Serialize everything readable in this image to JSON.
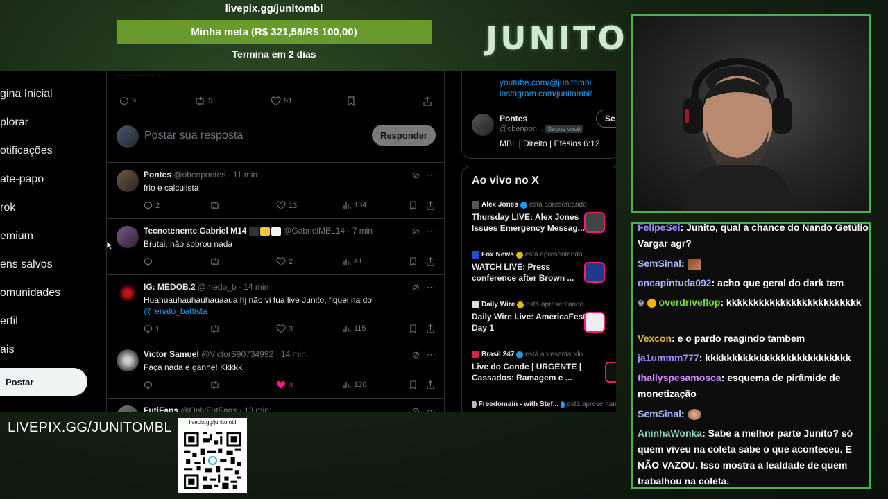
{
  "overlay": {
    "livepix_url": "livepix.gg/junitombl",
    "goal_text": "Minha meta (R$ 321,58/R$ 100,00)",
    "goal_progress": 1.0,
    "ends_text": "Termina em 2 dias",
    "logo": "JUNITO",
    "bottom_link": "LIVEPIX.GG/JUNITOMBL",
    "qr_label": "livepix.gg/junitombl"
  },
  "sidebar": {
    "items": [
      "gina Inicial",
      "plorar",
      "otificações",
      "ate-papo",
      "rok",
      "emium",
      "ens salvos",
      "omunidades",
      "erfil",
      "ais"
    ],
    "post_button": "Postar"
  },
  "feed": {
    "truncated_line": "... .... ..............",
    "top_actions": {
      "replies": "9",
      "reposts": "5",
      "likes": "91"
    },
    "reply_placeholder": "Postar sua resposta",
    "reply_button": "Responder",
    "tweets": [
      {
        "name": "Pontes",
        "handle": "@obenpontes · 11 min",
        "text": "frio e calculista",
        "replies": "2",
        "reposts": "",
        "likes": "13",
        "views": "134"
      },
      {
        "name": "Tecnotenente Gabriel M14",
        "handle": "@GabrielMBL14 · 7 min",
        "text": "Brutal, não sobrou nada",
        "replies": "",
        "reposts": "",
        "likes": "2",
        "views": "41"
      },
      {
        "name": "IG: MEDOB.2",
        "handle": "@medo_b · 14 min",
        "text": "Huahuauhauhauhauaaua hj não vi tua live Junito, fiquei na do",
        "mention": "@renato_battista",
        "replies": "1",
        "reposts": "",
        "likes": "3",
        "views": "115"
      },
      {
        "name": "Victor Samuel",
        "handle": "@VictorS90734992 · 14 min",
        "text": "Faça nada e ganhe! Kkkkk",
        "replies": "",
        "reposts": "",
        "likes": "3",
        "views": "120"
      },
      {
        "name": "FutiFans",
        "handle": "@OnlyFutFans · 13 min",
        "text": ""
      }
    ]
  },
  "right": {
    "links": [
      "youtube.com/@junitombl",
      "instagram.com/junitombl/"
    ],
    "profile": {
      "name": "Pontes",
      "handle": "@obenpon...",
      "follows_you": "Segue você",
      "bio": "MBL | Direito | Efésios 6:12",
      "follow_btn": "Se"
    },
    "live_title": "Ao vivo no X",
    "presenting": "está apresentando",
    "lives": [
      {
        "host": "Alex Jones",
        "title": "Thursday LIVE: Alex Jones Issues Emergency Messag...",
        "color": "#f91880"
      },
      {
        "host": "Fox News",
        "title": "WATCH LIVE: Press conference after Brown ...",
        "color": "#1d4ed8"
      },
      {
        "host": "Daily Wire",
        "title": "Daily Wire Live: AmericaFest Day 1",
        "color": "#ffffff"
      },
      {
        "host": "Brasil 247",
        "title": "Live do Conde | URGENTE | Cassados: Ramagem e ...",
        "color": "#e11d48"
      },
      {
        "host": "Freedomain - with Stef...",
        "title": "",
        "color": "#999"
      }
    ]
  },
  "chat": {
    "messages": [
      {
        "user": "FelipeSei",
        "color": "#9b8cff",
        "text": "Junito, qual a chance do Nando Getúlio Vargar agr?"
      },
      {
        "user": "SemSinal",
        "color": "#a7b4ff",
        "text": ""
      },
      {
        "user": "oncapintuda092",
        "color": "#a7b4ff",
        "text": "acho que geral do dark tem"
      },
      {
        "user": "overdriveflop",
        "color": "#7cdc4a",
        "text": "kkkkkkkkkkkkkkkkkkkkkkkkk"
      },
      {
        "user": "Vexcon",
        "color": "#e0b83a",
        "text": "e o pardo reagindo tambem"
      },
      {
        "user": "ja1ummm777",
        "color": "#9b8cff",
        "text": "kkkkkkkkkkkkkkkkkkkkkkkkkkk"
      },
      {
        "user": "thallyspesamosca",
        "color": "#d28cff",
        "text": "esquema de pirâmide de monetização"
      },
      {
        "user": "SemSinal",
        "color": "#a7b4ff",
        "text": ""
      },
      {
        "user": "AninhaWonka",
        "color": "#8cd7b8",
        "text": "Sabe a melhor parte Junito? só quem viveu na coleta sabe o que aconteceu. E NÃO VAZOU. Isso mostra a lealdade de quem trabalhou na coleta."
      }
    ]
  }
}
